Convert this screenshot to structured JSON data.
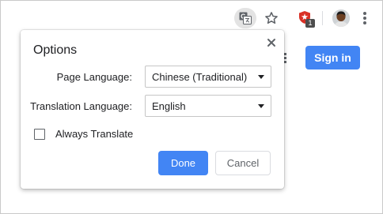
{
  "toolbar": {
    "icons": [
      "translate-icon",
      "star-icon",
      "extension-icon",
      "avatar",
      "more-menu-icon"
    ],
    "extension_badge": "1"
  },
  "page": {
    "sign_in_label": "Sign in"
  },
  "dialog": {
    "title": "Options",
    "page_language_label": "Page Language:",
    "page_language_value": "Chinese (Traditional)",
    "translation_language_label": "Translation Language:",
    "translation_language_value": "English",
    "always_translate_label": "Always Translate",
    "always_translate_checked": false,
    "done_label": "Done",
    "cancel_label": "Cancel"
  },
  "colors": {
    "accent": "#4285f4",
    "extension_red": "#d93025",
    "text": "#202124",
    "muted": "#5f6368"
  }
}
